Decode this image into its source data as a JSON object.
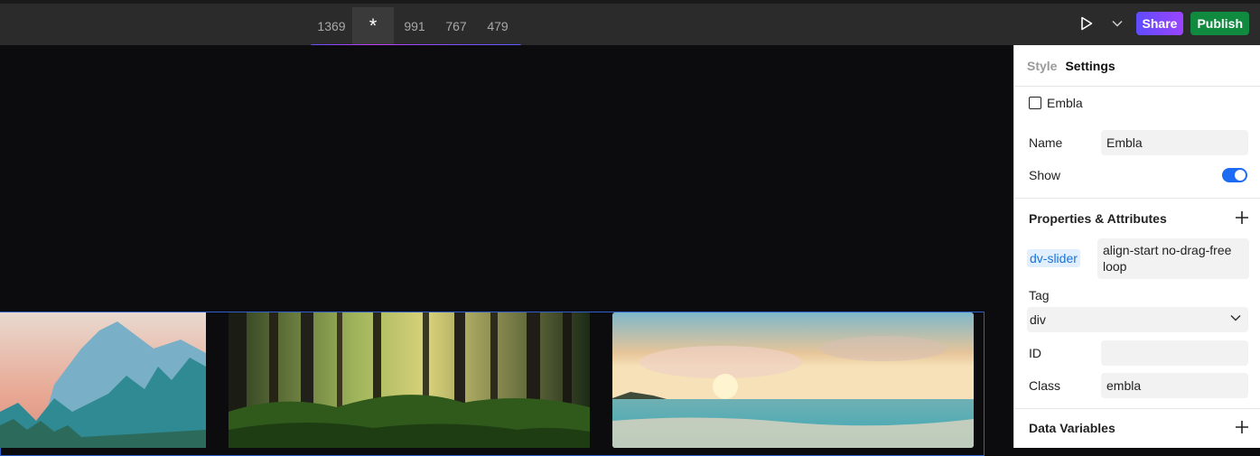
{
  "breakpoints": {
    "items": [
      "1369",
      "991",
      "767",
      "479"
    ],
    "base_symbol": "*"
  },
  "toolbar": {
    "share_label": "Share",
    "publish_label": "Publish"
  },
  "panel": {
    "tabs": {
      "style": "Style",
      "settings": "Settings"
    },
    "element_label": "Embla",
    "name_label": "Name",
    "name_value": "Embla",
    "show_label": "Show",
    "show_on": true,
    "properties_title": "Properties & Attributes",
    "attribute_key": "dv-slider",
    "attribute_value": "align-start no-drag-free loop",
    "tag_label": "Tag",
    "tag_value": "div",
    "id_label": "ID",
    "id_value": "",
    "class_label": "Class",
    "class_value": "embla",
    "data_variables_title": "Data Variables"
  },
  "colors": {
    "accent_blue": "#1d6bf3",
    "publish_green": "#0f8a3f",
    "share_purple": "#7a48ff"
  },
  "icons": [
    "play-icon",
    "chevron-down-icon",
    "plus-icon",
    "square-icon"
  ]
}
